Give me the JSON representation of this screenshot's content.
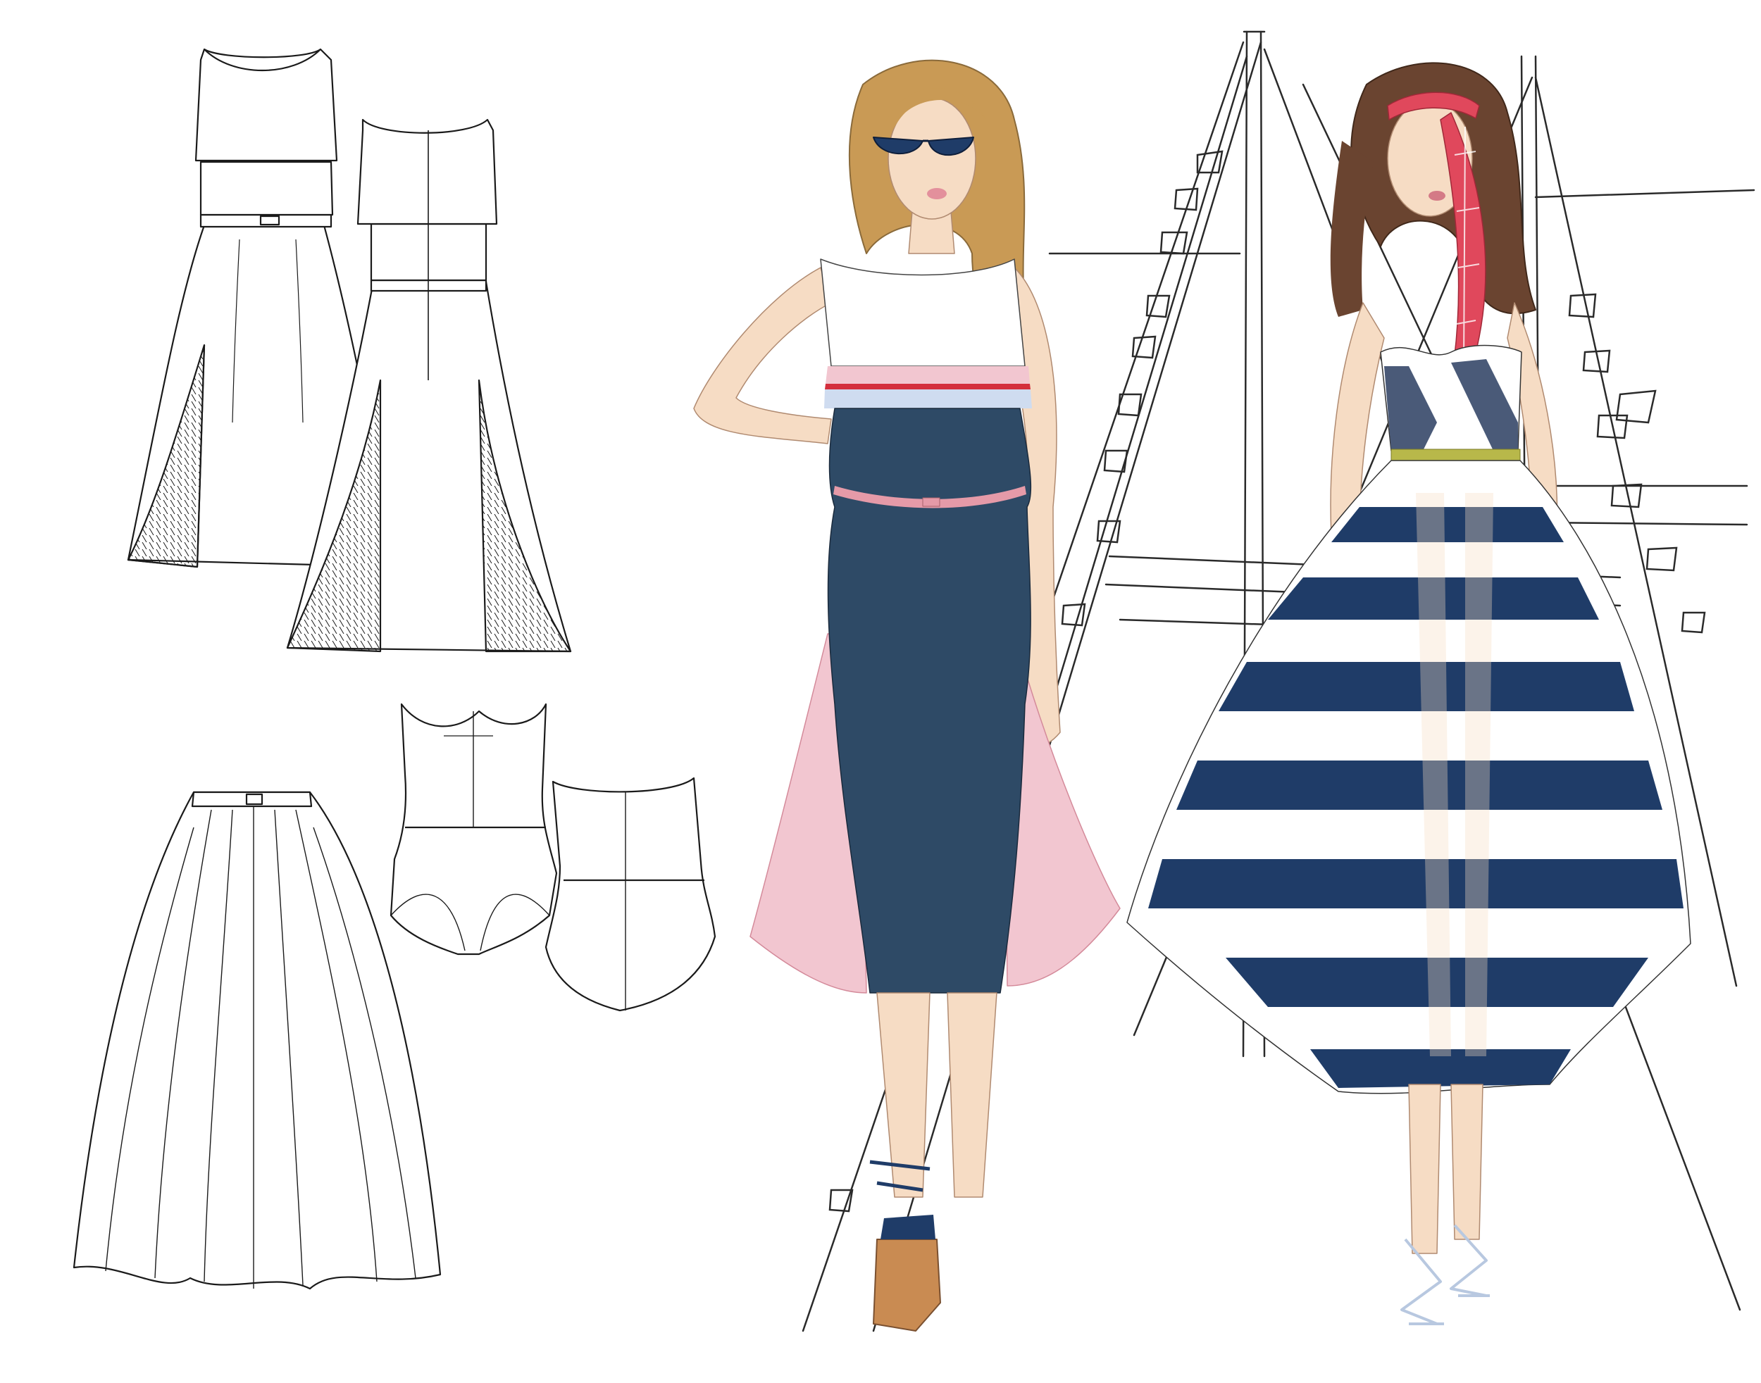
{
  "palette": {
    "background": "#ffffff",
    "outline": "#1a1a1a",
    "navy": "#2e4a66",
    "stripe_navy": "#1f3c68",
    "pleat_pink": "#f2c6d0",
    "belt_pink": "#e59aa8",
    "trim_red": "#d42e3c",
    "trim_light_blue": "#cfdcf0",
    "olive_belt": "#b8b84a",
    "skin": "#f6dcc4",
    "hair_blonde": "#c99a55",
    "hair_brown": "#6a4430",
    "plaid_red": "#e0485c",
    "wedge_tan": "#c98b52"
  },
  "sketches": {
    "flat_dress_front": "popover-dress-front-flat",
    "flat_dress_back": "popover-dress-back-flat",
    "flat_bodysuit_front": "bodysuit-front-flat",
    "flat_bodysuit_back": "bodysuit-back-flat",
    "flat_skirt": "full-midi-skirt-flat",
    "figure_left": "figure-navy-popover-dress",
    "figure_right": "figure-striped-bodysuit-skirt",
    "background": "ship-mast-rigging"
  }
}
